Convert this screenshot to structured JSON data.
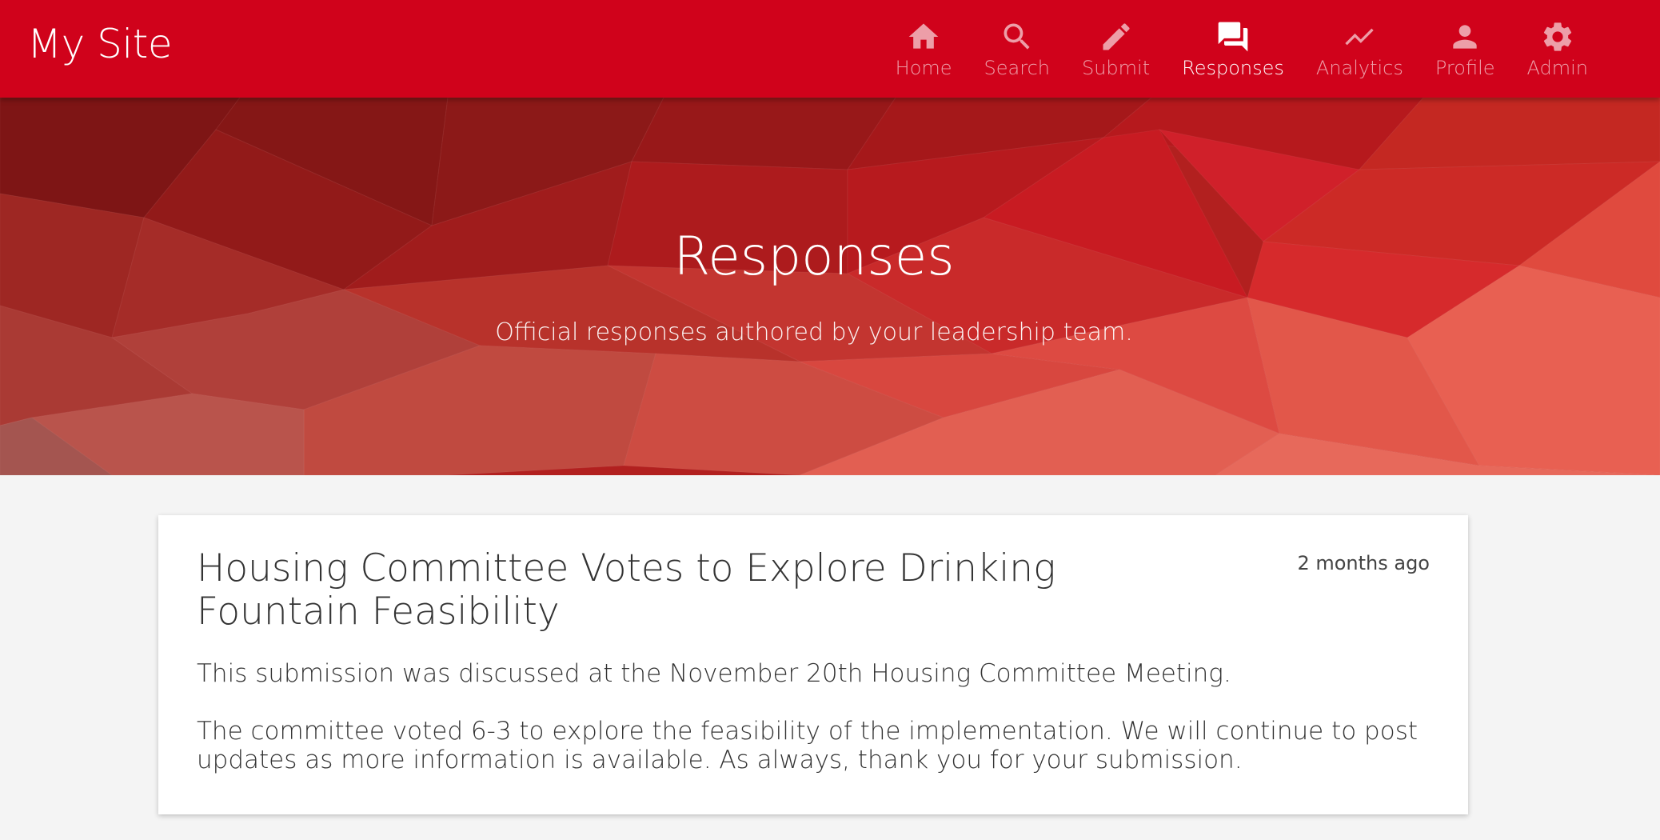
{
  "header": {
    "brand": "My Site",
    "nav": [
      {
        "label": "Home",
        "icon": "home-icon",
        "active": false
      },
      {
        "label": "Search",
        "icon": "search-icon",
        "active": false
      },
      {
        "label": "Submit",
        "icon": "pencil-icon",
        "active": false
      },
      {
        "label": "Responses",
        "icon": "chat-icon",
        "active": true
      },
      {
        "label": "Analytics",
        "icon": "trending-icon",
        "active": false
      },
      {
        "label": "Profile",
        "icon": "person-icon",
        "active": false
      },
      {
        "label": "Admin",
        "icon": "gear-icon",
        "active": false
      }
    ]
  },
  "hero": {
    "title": "Responses",
    "subtitle": "Official responses authored by your leadership team."
  },
  "responses": [
    {
      "title": "Housing Committee Votes to Explore Drinking Fountain Feasibility",
      "time": "2 months ago",
      "paragraphs": [
        "This submission was discussed at the November 20th Housing Committee Meeting.",
        "The committee voted 6-3 to explore the feasibility of the implementation. We will continue to post updates as more information is available. As always, thank you for your submission."
      ]
    }
  ],
  "colors": {
    "brand_red": "#d0021b",
    "page_bg": "#f4f4f4"
  }
}
